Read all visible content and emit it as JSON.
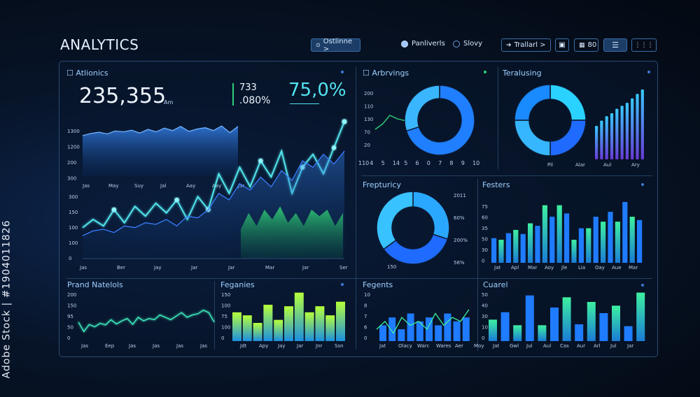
{
  "side_id": "Adobe Stock | #1904011826",
  "header": {
    "title": "ANALYTICS",
    "dropdown_label": "Ostlinne >",
    "radio_1": "Panliverls",
    "radio_2": "Slovy",
    "button_1": "Trallarl >",
    "button_2": "80"
  },
  "main": {
    "label": "Atlionics",
    "value": "235,355",
    "value_suffix": "Am",
    "mini_1": "733",
    "mini_2": ".080%",
    "percent": "75,0%",
    "upper_y": [
      "1300",
      "1200",
      "200",
      "300"
    ],
    "upper_x": [
      "Jas",
      "May",
      "Suy",
      "Jal",
      "Aay",
      "Aay",
      "Jar"
    ],
    "lower_y": [
      "300",
      "150",
      "100",
      "100",
      "0"
    ],
    "lower_x": [
      "Jas",
      "Ber",
      "Jay",
      "Jar",
      "Jar",
      "Mar",
      "Jar",
      "Ser"
    ]
  },
  "panels": {
    "arbrvings": {
      "label": "Arbrvings",
      "y": [
        "200",
        "110",
        "130",
        "70",
        "20"
      ],
      "x": [
        "110",
        "4",
        "5",
        "14",
        "5",
        "6",
        "0",
        "7",
        "8",
        "9",
        "10"
      ]
    },
    "teralusing": {
      "label": "Teralusing",
      "x": [
        "Pil",
        "Alar",
        "Aul",
        "Ary"
      ]
    },
    "frepturicy": {
      "label": "Frepturicy",
      "ticks": [
        "2011",
        "60%",
        "200%",
        "56%"
      ],
      "bottom": "150"
    },
    "festers": {
      "label": "Festers",
      "y": [
        "75",
        "60",
        "35",
        "50",
        "30",
        "0"
      ],
      "x": [
        "Jat",
        "Apl",
        "Mar",
        "Aoy",
        "Jle",
        "Lia",
        "Oay",
        "Aue",
        "Mar"
      ]
    },
    "prand": {
      "label": "Prand Natelols",
      "y": [
        "200",
        "150",
        "95",
        "50",
        "0"
      ],
      "x": [
        "Jas",
        "Eep",
        "Jas",
        "Jas",
        "Jas",
        "Jas"
      ]
    },
    "feganies": {
      "label": "Feganies",
      "y": [
        "150",
        "100",
        "75",
        "100",
        "0"
      ],
      "x": [
        "Jdt",
        "Apy",
        "Jay",
        "Jar",
        "Jnr",
        "Ssn"
      ]
    },
    "fegents": {
      "label": "Fegents",
      "y": [
        "10",
        "8",
        "7",
        "6",
        "0"
      ],
      "x": [
        "Jat",
        "Olacy",
        "Warc",
        "Wares",
        "Aer",
        "Moy"
      ]
    },
    "cuarel": {
      "label": "Cuarel",
      "y": [
        "50",
        "40",
        "30",
        "10",
        "0"
      ],
      "x": [
        "Jat",
        "Gwl",
        "Jul",
        "Aul",
        "Cas",
        "Aur",
        "Arl",
        "Jul",
        "Jar"
      ]
    }
  },
  "chart_data": [
    {
      "type": "area",
      "name": "upper-area",
      "x": [
        "Jas",
        "May",
        "Suy",
        "Jal",
        "Aay",
        "Aay",
        "Jar"
      ],
      "values": [
        1080,
        1130,
        1160,
        1120,
        1190,
        1170,
        1210,
        1140,
        1230,
        1170,
        1260,
        1200,
        1300,
        1180,
        1240,
        1270,
        1200,
        1310,
        1150,
        1300
      ],
      "ylim": [
        100,
        1400
      ]
    },
    {
      "type": "line",
      "name": "lower-lines",
      "x": [
        "Jas",
        "Ber",
        "Jay",
        "Jar",
        "Jar",
        "Mar",
        "Jar",
        "Ser"
      ],
      "series": [
        {
          "values": [
            95,
            120,
            100,
            150,
            110,
            160,
            130,
            170,
            140,
            180,
            120,
            190,
            150,
            260,
            200,
            280,
            220,
            300,
            250,
            330,
            200,
            280,
            320,
            260,
            340,
            420
          ]
        },
        {
          "values": [
            70,
            85,
            90,
            80,
            100,
            95,
            110,
            105,
            120,
            100,
            130,
            125,
            150,
            200,
            180,
            230,
            210,
            250,
            220,
            270,
            240,
            300,
            280,
            320,
            290,
            330
          ]
        }
      ],
      "ylim": [
        0,
        450
      ]
    },
    {
      "type": "area",
      "name": "lower-green",
      "values": [
        90,
        140,
        100,
        150,
        120,
        160,
        110,
        140,
        100,
        150,
        130,
        150,
        100,
        140
      ],
      "ylim": [
        0,
        450
      ]
    },
    {
      "type": "pie",
      "name": "arbrvings-donut",
      "slices": [
        70,
        30
      ]
    },
    {
      "type": "line",
      "name": "arbrvings-line",
      "values": [
        60,
        90,
        140,
        120,
        110
      ]
    },
    {
      "type": "pie",
      "name": "teralusing-donut",
      "slices": [
        25,
        25,
        25,
        25
      ]
    },
    {
      "type": "bar",
      "name": "teralusing-bars",
      "values": [
        45,
        52,
        58,
        62,
        68,
        72,
        76,
        82,
        88,
        94
      ]
    },
    {
      "type": "pie",
      "name": "frepturicy-donut",
      "slices": [
        30,
        35,
        35
      ]
    },
    {
      "type": "bar",
      "name": "festers-bars",
      "categories": [
        "Jat",
        "Apl",
        "Mar",
        "Aoy",
        "Jle",
        "Lia",
        "Oay",
        "Aue",
        "Mar"
      ],
      "values": [
        30,
        28,
        36,
        40,
        35,
        48,
        45,
        70,
        56,
        70,
        60,
        28,
        42,
        42,
        56,
        50,
        62,
        50,
        74,
        56,
        52
      ],
      "ylim": [
        0,
        85
      ]
    },
    {
      "type": "line",
      "name": "prand-line",
      "x": [
        "Jas",
        "Eep",
        "Jas",
        "Jas",
        "Jas",
        "Jas"
      ],
      "values": [
        80,
        40,
        70,
        60,
        75,
        68,
        90,
        72,
        85,
        95,
        70,
        100,
        85,
        95,
        90,
        110,
        100,
        90,
        105,
        120,
        100,
        110,
        115,
        130,
        120,
        80
      ],
      "ylim": [
        0,
        200
      ]
    },
    {
      "type": "bar",
      "name": "feganies-bars",
      "categories": [
        "Jdt",
        "Apy",
        "Jay",
        "Jar",
        "Jnr",
        "Ssn"
      ],
      "values": [
        95,
        85,
        60,
        120,
        70,
        115,
        160,
        95,
        115,
        85,
        130
      ],
      "ylim": [
        0,
        180
      ]
    },
    {
      "type": "bar",
      "name": "fegents-bars",
      "categories": [
        "Jat",
        "Olacy",
        "Warc",
        "Wares",
        "Aer",
        "Moy"
      ],
      "values": [
        4,
        6,
        3,
        7,
        5,
        6,
        4,
        7,
        5,
        6
      ],
      "ylim": [
        0,
        11
      ]
    },
    {
      "type": "line",
      "name": "fegents-line",
      "values": [
        3,
        5,
        2,
        6,
        4,
        5,
        3,
        7,
        4,
        6,
        5,
        8
      ],
      "ylim": [
        0,
        11
      ]
    },
    {
      "type": "bar",
      "name": "cuarel-bars",
      "categories": [
        "Jat",
        "Gwl",
        "Jul",
        "Aul",
        "Cas",
        "Aur",
        "Arl",
        "Jul",
        "Jar"
      ],
      "values": [
        23,
        31,
        17,
        49,
        17,
        36,
        47,
        18,
        42,
        30,
        38,
        16,
        52
      ],
      "ylim": [
        0,
        60
      ]
    }
  ]
}
